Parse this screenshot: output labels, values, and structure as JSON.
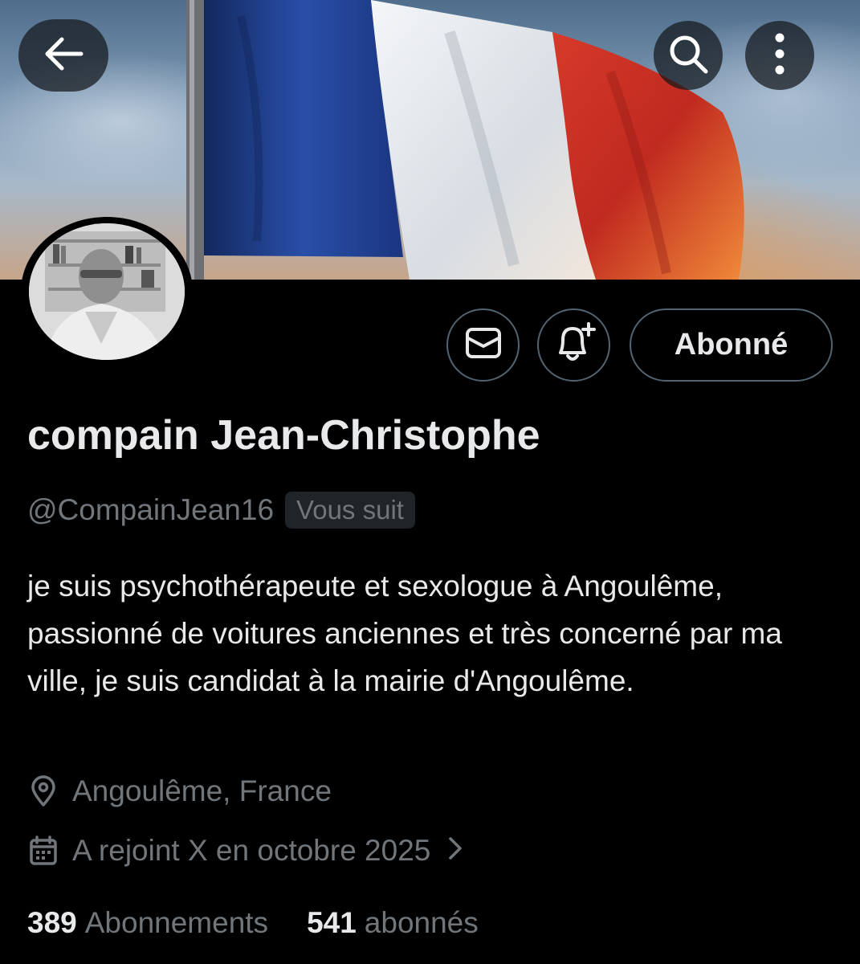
{
  "header": {
    "back_icon": "arrow-left-icon",
    "search_icon": "search-icon",
    "more_icon": "more-vertical-icon"
  },
  "actions": {
    "message_icon": "envelope-icon",
    "notify_icon": "bell-plus-icon",
    "follow_label": "Abonné"
  },
  "profile": {
    "name": "compain Jean-Christophe",
    "handle": "@CompainJean16",
    "follows_you_badge": "Vous suit",
    "bio": "je suis psychothérapeute et sexologue à Angoulême, passionné de voitures anciennes et très concerné par ma ville, je suis candidat à la mairie d'Angoulême.",
    "location": "Angoulême, France",
    "joined": "A rejoint X en octobre 2025"
  },
  "stats": {
    "following_count": "389",
    "following_label": "Abonnements",
    "followers_count": "541",
    "followers_label": "abonnés"
  },
  "colors": {
    "background": "#000000",
    "primary_text": "#e7e9ea",
    "secondary_text": "#71767b",
    "border": "#536471",
    "flag_blue": "#1f3f8f",
    "flag_white": "#e8ecf0",
    "flag_red": "#d63a2a"
  }
}
